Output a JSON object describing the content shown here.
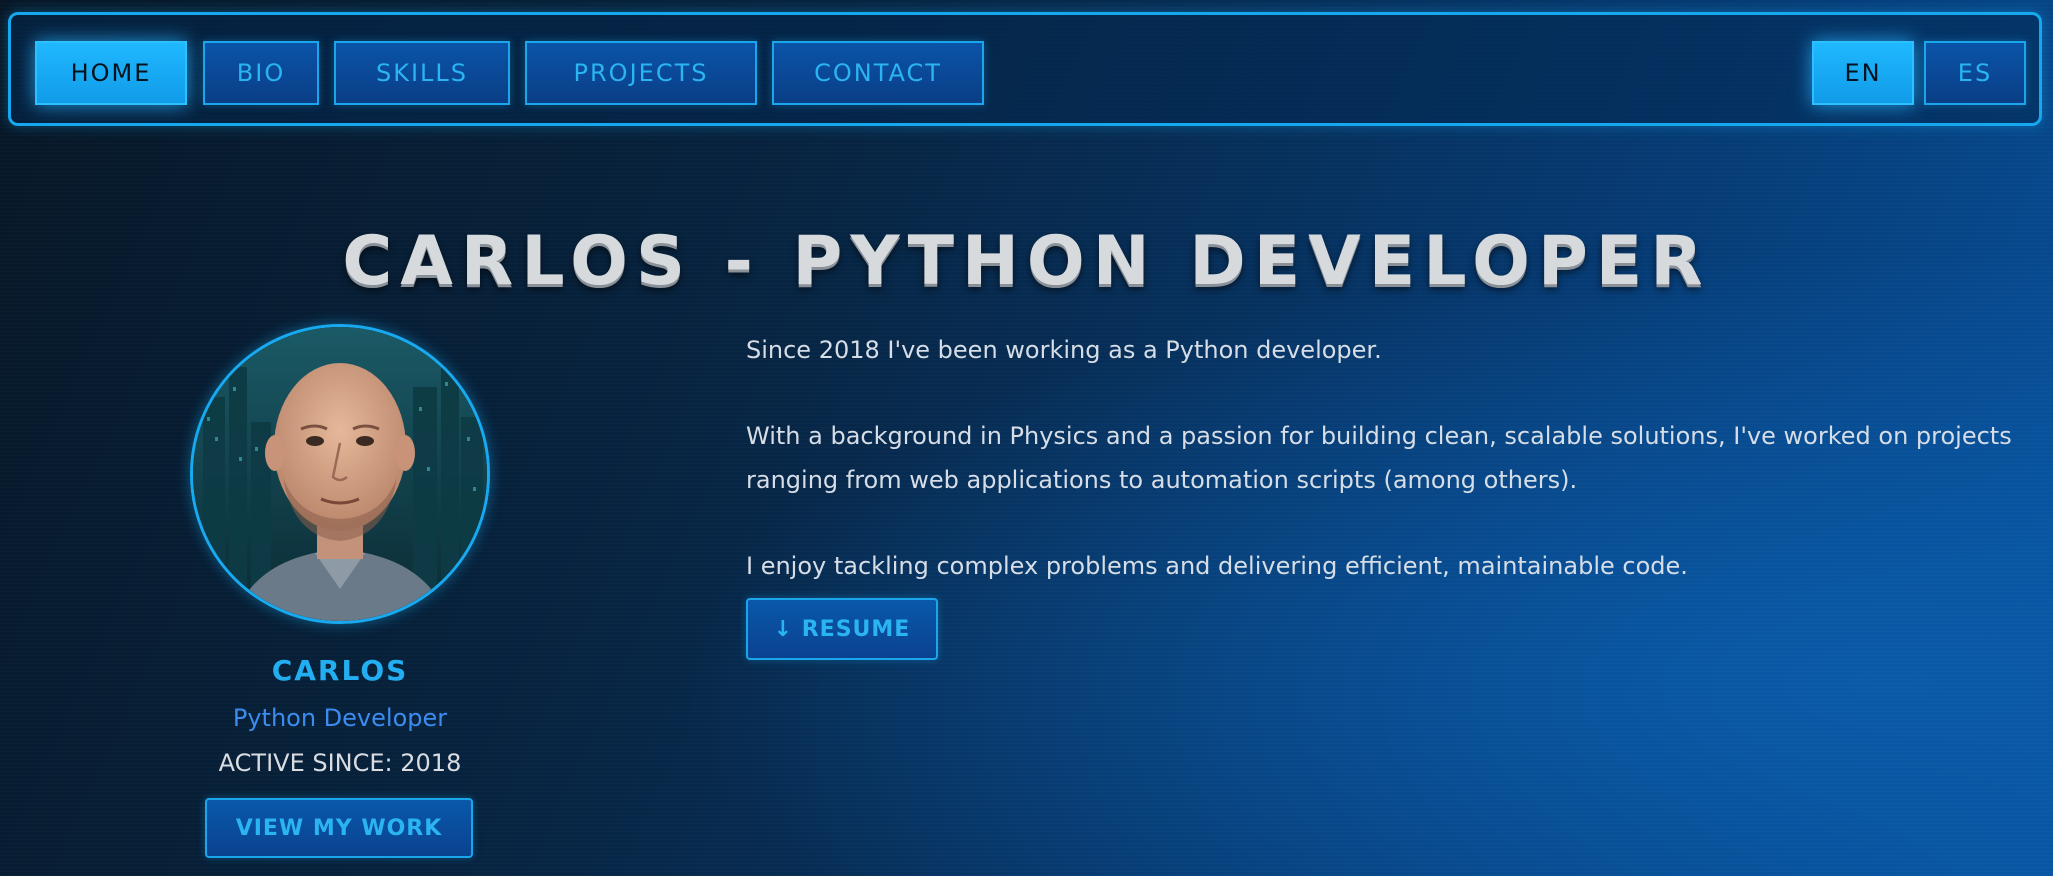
{
  "nav": {
    "items": [
      {
        "label": "HOME",
        "active": true
      },
      {
        "label": "BIO",
        "active": false
      },
      {
        "label": "SKILLS",
        "active": false
      },
      {
        "label": "PROJECTS",
        "active": false
      },
      {
        "label": "CONTACT",
        "active": false
      }
    ],
    "languages": [
      {
        "label": "EN",
        "active": true
      },
      {
        "label": "ES",
        "active": false
      }
    ]
  },
  "header": {
    "title": "CARLOS - PYTHON DEVELOPER"
  },
  "profile": {
    "name": "CARLOS",
    "role": "Python Developer",
    "since": "ACTIVE SINCE: 2018",
    "work_button": "VIEW MY WORK"
  },
  "bio": {
    "paragraphs": [
      "Since 2018 I've been working as a Python developer.",
      "With a background in Physics and a passion for building clean, scalable solutions, I've worked on projects ranging from web applications to automation scripts (among others).",
      "I enjoy tackling complex problems and delivering efficient, maintainable code."
    ],
    "resume_button": "↓ RESUME"
  },
  "colors": {
    "accent": "#1ba6ec",
    "accent_active": "#1fb8ff",
    "role_text": "#3c8cf0",
    "background_dark": "#071726",
    "background_blue": "#0753a0"
  }
}
